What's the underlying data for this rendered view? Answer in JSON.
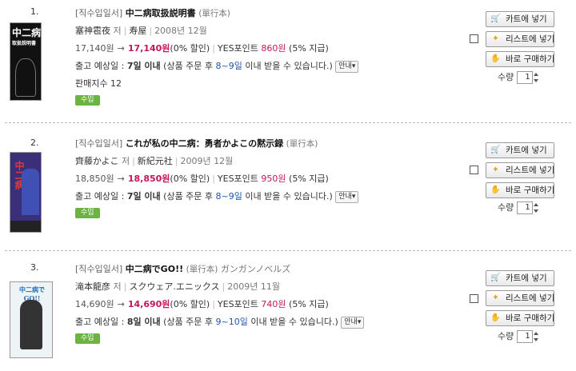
{
  "items": [
    {
      "rank": "1.",
      "category": "[직수입일서]",
      "title": "中二病取扱説明書",
      "format": "(單行本)",
      "author": "塞神雹夜",
      "author_suffix": "저",
      "publisher": "寿屋",
      "date": "2008년 12월",
      "original_price": "17,140원",
      "sale_price": "17,140원",
      "discount": "(0% 할인)",
      "points_label": "YES포인트",
      "points": "860원",
      "points_rate": "(5% 지급)",
      "ship_label": "출고 예상일 :",
      "ship_days": "7일 이내",
      "ship_note_pre": "(상품 주문 후",
      "ship_range": "8~9일",
      "ship_note_post": "이내 받을 수 있습니다.)",
      "guide": "안내",
      "sales_index": "판매지수 12",
      "badge": "수입",
      "cover_text": "中二病",
      "cover_sub": "取扱説明書"
    },
    {
      "rank": "2.",
      "category": "[직수입일서]",
      "title": "これが私の中二病：勇者かよこの黙示録",
      "format": "(單行本)",
      "author": "齊藤かよこ",
      "author_suffix": "저",
      "publisher": "新紀元社",
      "date": "2009년 12월",
      "original_price": "18,850원",
      "sale_price": "18,850원",
      "discount": "(0% 할인)",
      "points_label": "YES포인트",
      "points": "950원",
      "points_rate": "(5% 지급)",
      "ship_label": "출고 예상일 :",
      "ship_days": "7일 이내",
      "ship_note_pre": "(상품 주문 후",
      "ship_range": "8~9일",
      "ship_note_post": "이내 받을 수 있습니다.)",
      "guide": "안내",
      "badge": "수입",
      "cover_text": "中二病"
    },
    {
      "rank": "3.",
      "category": "[직수입일서]",
      "title": "中二病でGO!!",
      "format": "(單行本)",
      "series": "ガンガンノベルズ",
      "author": "滝本龍彦",
      "author_suffix": "저",
      "publisher": "スクウェア.エニックス",
      "date": "2009년 11월",
      "original_price": "14,690원",
      "sale_price": "14,690원",
      "discount": "(0% 할인)",
      "points_label": "YES포인트",
      "points": "740원",
      "points_rate": "(5% 지급)",
      "ship_label": "출고 예상일 :",
      "ship_days": "8일 이내",
      "ship_note_pre": "(상품 주문 후",
      "ship_range": "9~10일",
      "ship_note_post": "이내 받을 수 있습니다.)",
      "guide": "안내",
      "badge": "수입",
      "cover_text": "中二病でGO!!"
    }
  ],
  "buttons": {
    "cart": "카트에 넣기",
    "list": "리스트에 넣기",
    "buy": "바로 구매하기"
  },
  "icons": {
    "cart": "shopping-cart-icon",
    "list": "wishlist-icon",
    "buy": "buy-now-icon"
  },
  "quantity_label": "수량",
  "quantity_value": "1",
  "colors": {
    "sale_price": "#c2185b",
    "badge": "#6cb33f",
    "ship_range": "#2255aa"
  }
}
